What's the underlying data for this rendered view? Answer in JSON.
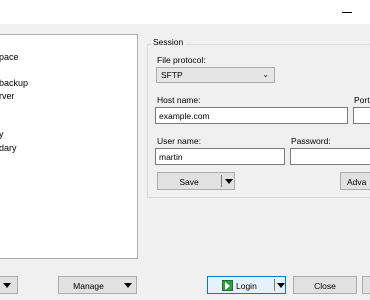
{
  "tree": {
    "items": [
      "pace",
      "backup",
      "rver",
      "y",
      "dary"
    ]
  },
  "session": {
    "group_label": "Session",
    "file_protocol_label": "File protocol:",
    "file_protocol_value": "SFTP",
    "host_label": "Host name:",
    "host_value": "example.com",
    "port_label": "Port",
    "user_label": "User name:",
    "user_value": "martin",
    "password_label": "Password:",
    "password_value": "",
    "save_label": "Save",
    "advanced_label": "Adva"
  },
  "footer": {
    "manage_label": "Manage",
    "login_label": "Login",
    "close_label": "Close"
  }
}
